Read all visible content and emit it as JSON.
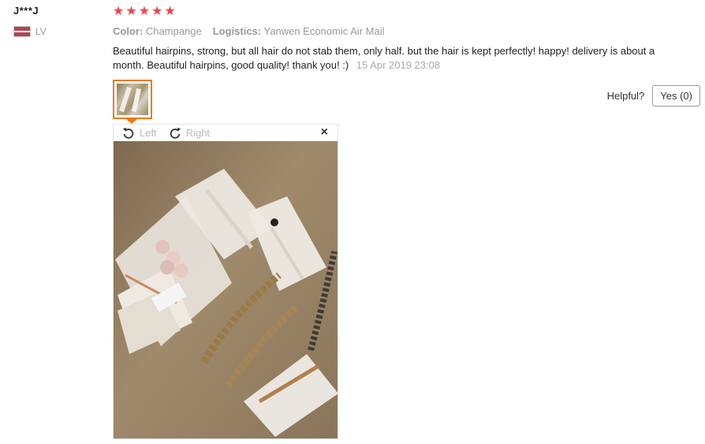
{
  "reviewer": {
    "name": "J***J",
    "country_code": "LV"
  },
  "rating": {
    "stars": 5,
    "star_glyphs": [
      "★",
      "★",
      "★",
      "★",
      "★"
    ],
    "color": "#f2454b"
  },
  "attributes": {
    "color_label": "Color:",
    "color_value": "Champange",
    "logistics_label": "Logistics:",
    "logistics_value": "Yanwen Economic Air Mail"
  },
  "review": {
    "text": "Beautiful hairpins, strong, but all hair do not stab them, only half. but the hair is kept perfectly! happy! delivery is about a month. Beautiful hairpins, good quality! thank you! :)",
    "date": "15 Apr 2019 23:08"
  },
  "helpful": {
    "label": "Helpful?",
    "yes_button": "Yes (0)"
  },
  "viewer": {
    "rotate_left": "Left",
    "rotate_right": "Right",
    "close": "×"
  },
  "colors": {
    "accent": "#f07a10",
    "flag_red": "#b2444f"
  }
}
